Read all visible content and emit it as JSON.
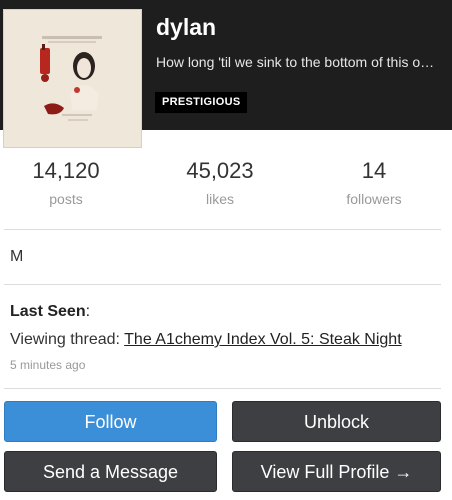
{
  "profile": {
    "username": "dylan",
    "tagline": "How long 'til we sink to the bottom of this ocean floor?",
    "badge": "PRESTIGIOUS"
  },
  "stats": [
    {
      "value": "14,120",
      "label": "posts"
    },
    {
      "value": "45,023",
      "label": "likes"
    },
    {
      "value": "14",
      "label": "followers"
    }
  ],
  "bio": "M",
  "last_seen": {
    "title": "Last Seen",
    "activity_prefix": "Viewing thread:",
    "thread_title": "The A1chemy Index Vol. 5: Steak Night",
    "time": "5 minutes ago"
  },
  "buttons": {
    "follow": "Follow",
    "unblock": "Unblock",
    "send_message": "Send a Message",
    "view_profile": "View Full Profile →"
  },
  "colors": {
    "header_bg": "#1e1e1e",
    "follow_blue": "#3a8fd8",
    "dark_button": "#3d3f42"
  }
}
